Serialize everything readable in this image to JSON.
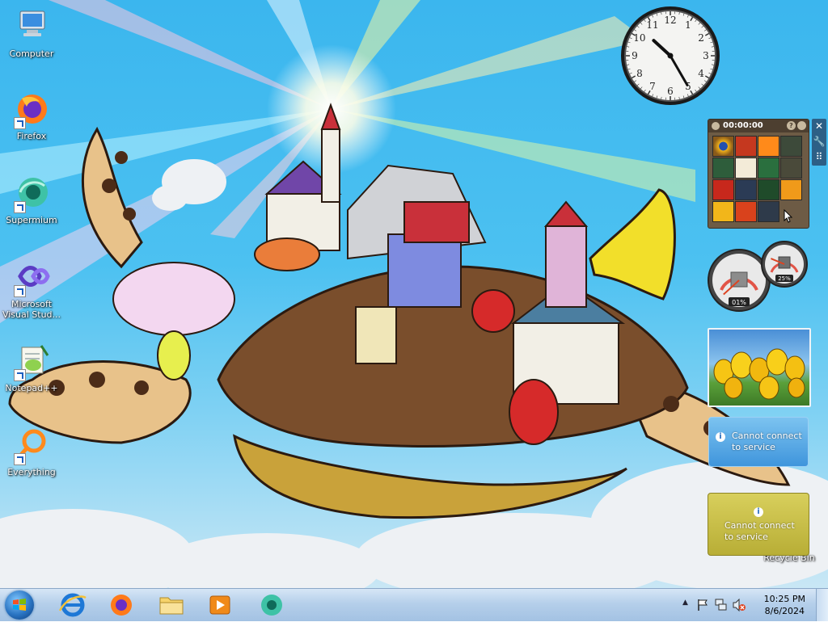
{
  "desktop": {
    "icons": [
      {
        "label": "Computer",
        "icon": "computer-icon"
      },
      {
        "label": "Firefox",
        "icon": "firefox-icon"
      },
      {
        "label": "Supermium",
        "icon": "supermium-icon"
      },
      {
        "label": "Microsoft Visual Stud...",
        "icon": "visual-studio-icon"
      },
      {
        "label": "Notepad++",
        "icon": "notepadpp-icon"
      },
      {
        "label": "Everything",
        "icon": "everything-icon"
      },
      {
        "label": "Recycle Bin",
        "icon": "recycle-bin-icon"
      }
    ]
  },
  "gadgets": {
    "clock": {
      "hour": 10,
      "minute": 25,
      "numerals": [
        "12",
        "1",
        "2",
        "3",
        "4",
        "5",
        "6",
        "7",
        "8",
        "9",
        "10",
        "11"
      ]
    },
    "puzzle": {
      "timer": "00:00:00",
      "help": "?"
    },
    "tools": {
      "close": "✕",
      "options": "🔧",
      "grip": "⠿"
    },
    "meters": {
      "cpu_percent": "01%",
      "memory_percent": "25%",
      "cpu": 1,
      "memory": 25
    },
    "weather": {
      "message_line1": "Cannot connect",
      "message_line2": "to service"
    },
    "currency": {
      "message_line1": "Cannot connect",
      "message_line2": "to service"
    }
  },
  "taskbar": {
    "start_label": "Start",
    "pinned": [
      {
        "name": "Internet Explorer",
        "icon": "internet-explorer-icon"
      },
      {
        "name": "Firefox",
        "icon": "firefox-icon"
      },
      {
        "name": "Windows Explorer",
        "icon": "folder-icon"
      },
      {
        "name": "Windows Media Player",
        "icon": "media-player-icon"
      },
      {
        "name": "Supermium",
        "icon": "supermium-icon"
      }
    ],
    "tray": {
      "show_hidden": "▲",
      "time": "10:25 PM",
      "date": "8/6/2024"
    }
  },
  "colors": {
    "sky": "#3bb6ee",
    "taskbar": "#b5cfea",
    "start_orb": "#2a74c2",
    "weather_gadget": "#3f95dc",
    "currency_gadget": "#c9bf44"
  }
}
